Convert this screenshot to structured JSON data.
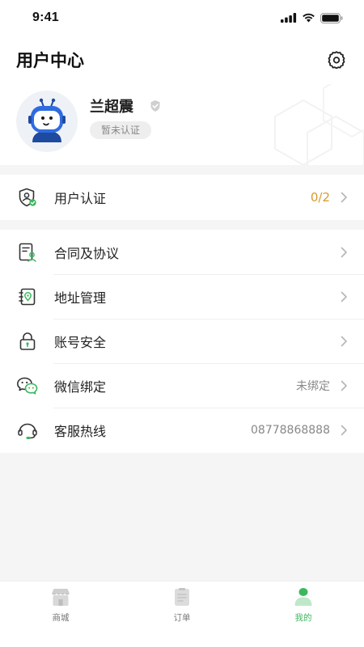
{
  "status_bar": {
    "time": "9:41"
  },
  "header": {
    "title": "用户中心"
  },
  "profile": {
    "name": "兰超震",
    "cert_status": "暂未认证"
  },
  "section_verify": {
    "label": "用户认证",
    "value": "0/2"
  },
  "menu": [
    {
      "label": "合同及协议",
      "value": ""
    },
    {
      "label": "地址管理",
      "value": ""
    },
    {
      "label": "账号安全",
      "value": ""
    },
    {
      "label": "微信绑定",
      "value": "未绑定"
    },
    {
      "label": "客服热线",
      "value": "08778868888"
    }
  ],
  "tabs": [
    {
      "label": "商城",
      "icon": "shop-icon"
    },
    {
      "label": "订单",
      "icon": "order-icon"
    },
    {
      "label": "我的",
      "icon": "profile-icon",
      "active": true
    }
  ],
  "colors": {
    "accent": "#3bb85e",
    "value_orange": "#d99a2b"
  }
}
